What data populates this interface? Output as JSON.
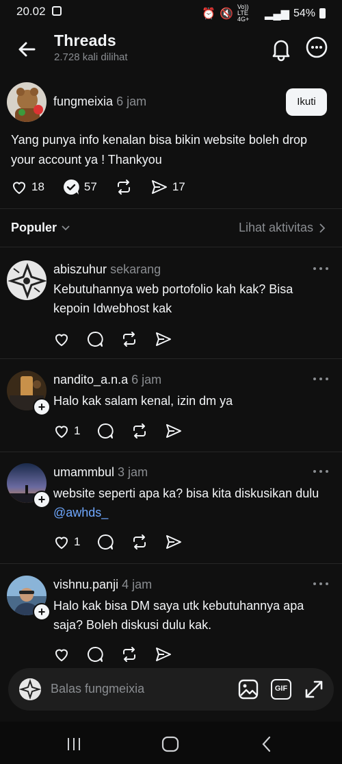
{
  "status_bar": {
    "time": "20.02",
    "network": "Vo)) LTE 4G+",
    "battery": "54%"
  },
  "app_bar": {
    "title": "Threads",
    "subtitle": "2.728 kali dilihat"
  },
  "post": {
    "username": "fungmeixia",
    "time": "6 jam",
    "follow_label": "Ikuti",
    "text": "Yang punya info kenalan bisa bikin website boleh drop your account ya ! Thankyou",
    "likes": "18",
    "replies": "57",
    "shares": "17"
  },
  "filter": {
    "sort_label": "Populer",
    "activity_label": "Lihat aktivitas"
  },
  "replies": [
    {
      "username": "abiszuhur",
      "time": "sekarang",
      "text": "Kebutuhannya web portofolio kah kak? Bisa kepoin Idwebhost kak",
      "likes": ""
    },
    {
      "username": "nandito_a.n.a",
      "time": "6 jam",
      "text": "Halo kak salam kenal, izin dm ya",
      "likes": "1"
    },
    {
      "username": "umammbul",
      "time": "3 jam",
      "text_before": "website seperti apa ka? bisa kita diskusikan dulu ",
      "mention": "@awhds_",
      "likes": "1"
    },
    {
      "username": "vishnu.panji",
      "time": "4 jam",
      "text": "Halo kak bisa DM saya utk kebutuhannya apa saja? Boleh diskusi dulu kak.",
      "likes": ""
    }
  ],
  "composer": {
    "placeholder": "Balas fungmeixia",
    "gif_label": "GIF"
  },
  "colors": {
    "background": "#101010",
    "text": "#f3f5f7",
    "muted": "#8a8d91",
    "mention": "#6fa8ff"
  }
}
